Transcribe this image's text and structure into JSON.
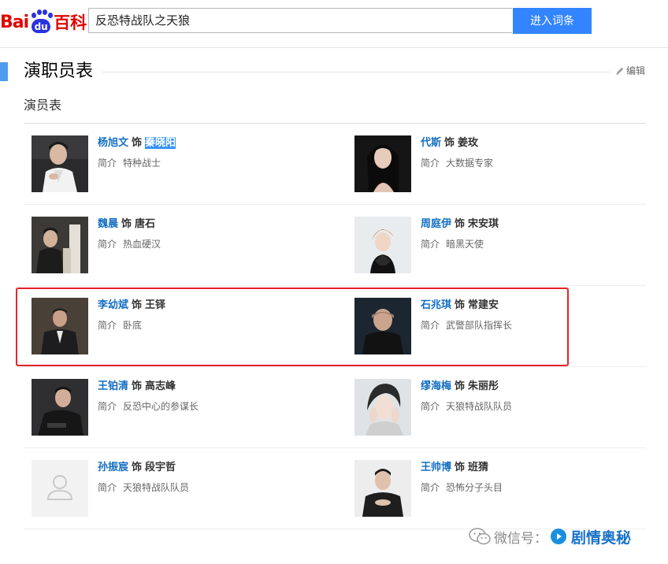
{
  "header": {
    "logo": {
      "bai": "Bai",
      "du": "du",
      "baike": "百科"
    },
    "search": {
      "value": "反恐特战队之天狼"
    },
    "search_button": "进入词条"
  },
  "section": {
    "title": "演职员表",
    "edit_label": "编辑",
    "subsection_title": "演员表"
  },
  "intro_label": "简介",
  "as_label": "饰",
  "cast": [
    {
      "actor": "杨旭文",
      "role": "秦晓阳",
      "intro": "特种战士",
      "role_highlighted": true
    },
    {
      "actor": "代斯",
      "role": "姜玫",
      "intro": "大数据专家"
    },
    {
      "actor": "魏晨",
      "role": "唐石",
      "intro": "热血硬汉"
    },
    {
      "actor": "周庭伊",
      "role": "宋安琪",
      "intro": "暗黑天使"
    },
    {
      "actor": "李幼斌",
      "role": "王铎",
      "intro": "卧底"
    },
    {
      "actor": "石兆琪",
      "role": "常建安",
      "intro": "武警部队指挥长"
    },
    {
      "actor": "王铂清",
      "role": "高志峰",
      "intro": "反恐中心的参谋长"
    },
    {
      "actor": "缪海梅",
      "role": "朱丽彤",
      "intro": "天狼特战队队员"
    },
    {
      "actor": "孙振宸",
      "role": "段宇哲",
      "intro": "天狼特战队队员"
    },
    {
      "actor": "王帅博",
      "role": "班猜",
      "intro": "恐怖分子头目"
    }
  ],
  "watermark": {
    "text": "微信号：",
    "brand": "剧情奥秘"
  },
  "colors": {
    "link_blue": "#136ec2",
    "button_blue": "#3385ff",
    "highlight_red": "#e5232a",
    "section_marker": "#4f9cee"
  }
}
